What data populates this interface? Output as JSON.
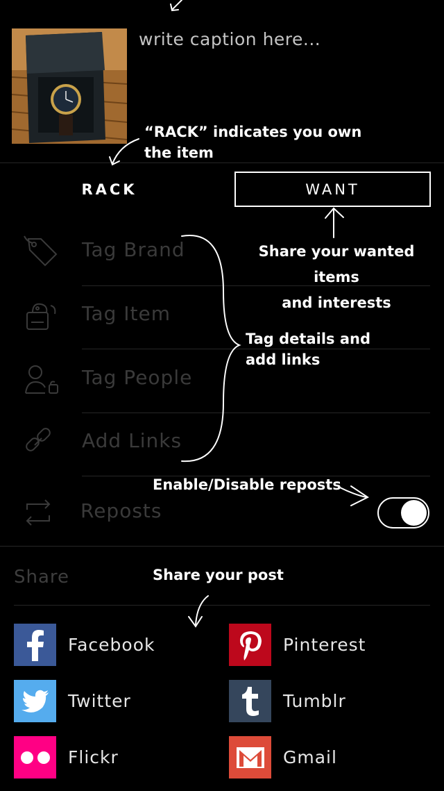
{
  "caption": {
    "placeholder": "write caption here..."
  },
  "annotations": {
    "rack_note_line1": "“RACK”  indicates you own",
    "rack_note_line2": "the item",
    "want_note_line1": "Share your wanted items",
    "want_note_line2": "and interests",
    "tag_note_line1": "Tag details and",
    "tag_note_line2": "add links",
    "repost_note": "Enable/Disable reposts",
    "share_note": "Share your post"
  },
  "tabs": {
    "rack": "RACK",
    "want": "WANT"
  },
  "tag_rows": [
    {
      "label": "Tag Brand",
      "icon": "tag-icon"
    },
    {
      "label": "Tag Item",
      "icon": "price-tag-icon"
    },
    {
      "label": "Tag People",
      "icon": "person-tag-icon"
    },
    {
      "label": "Add Links",
      "icon": "link-icon"
    }
  ],
  "reposts": {
    "label": "Reposts",
    "icon": "repost-icon",
    "enabled": true
  },
  "share": {
    "title": "Share",
    "services": [
      {
        "label": "Facebook",
        "icon": "facebook-icon",
        "color": "#3b5998"
      },
      {
        "label": "Pinterest",
        "icon": "pinterest-icon",
        "color": "#bd081c"
      },
      {
        "label": "Twitter",
        "icon": "twitter-icon",
        "color": "#55acee"
      },
      {
        "label": "Tumblr",
        "icon": "tumblr-icon",
        "color": "#35465c"
      },
      {
        "label": "Flickr",
        "icon": "flickr-icon",
        "color": "#ff0084"
      },
      {
        "label": "Gmail",
        "icon": "gmail-icon",
        "color": "#dd4b39"
      }
    ]
  }
}
